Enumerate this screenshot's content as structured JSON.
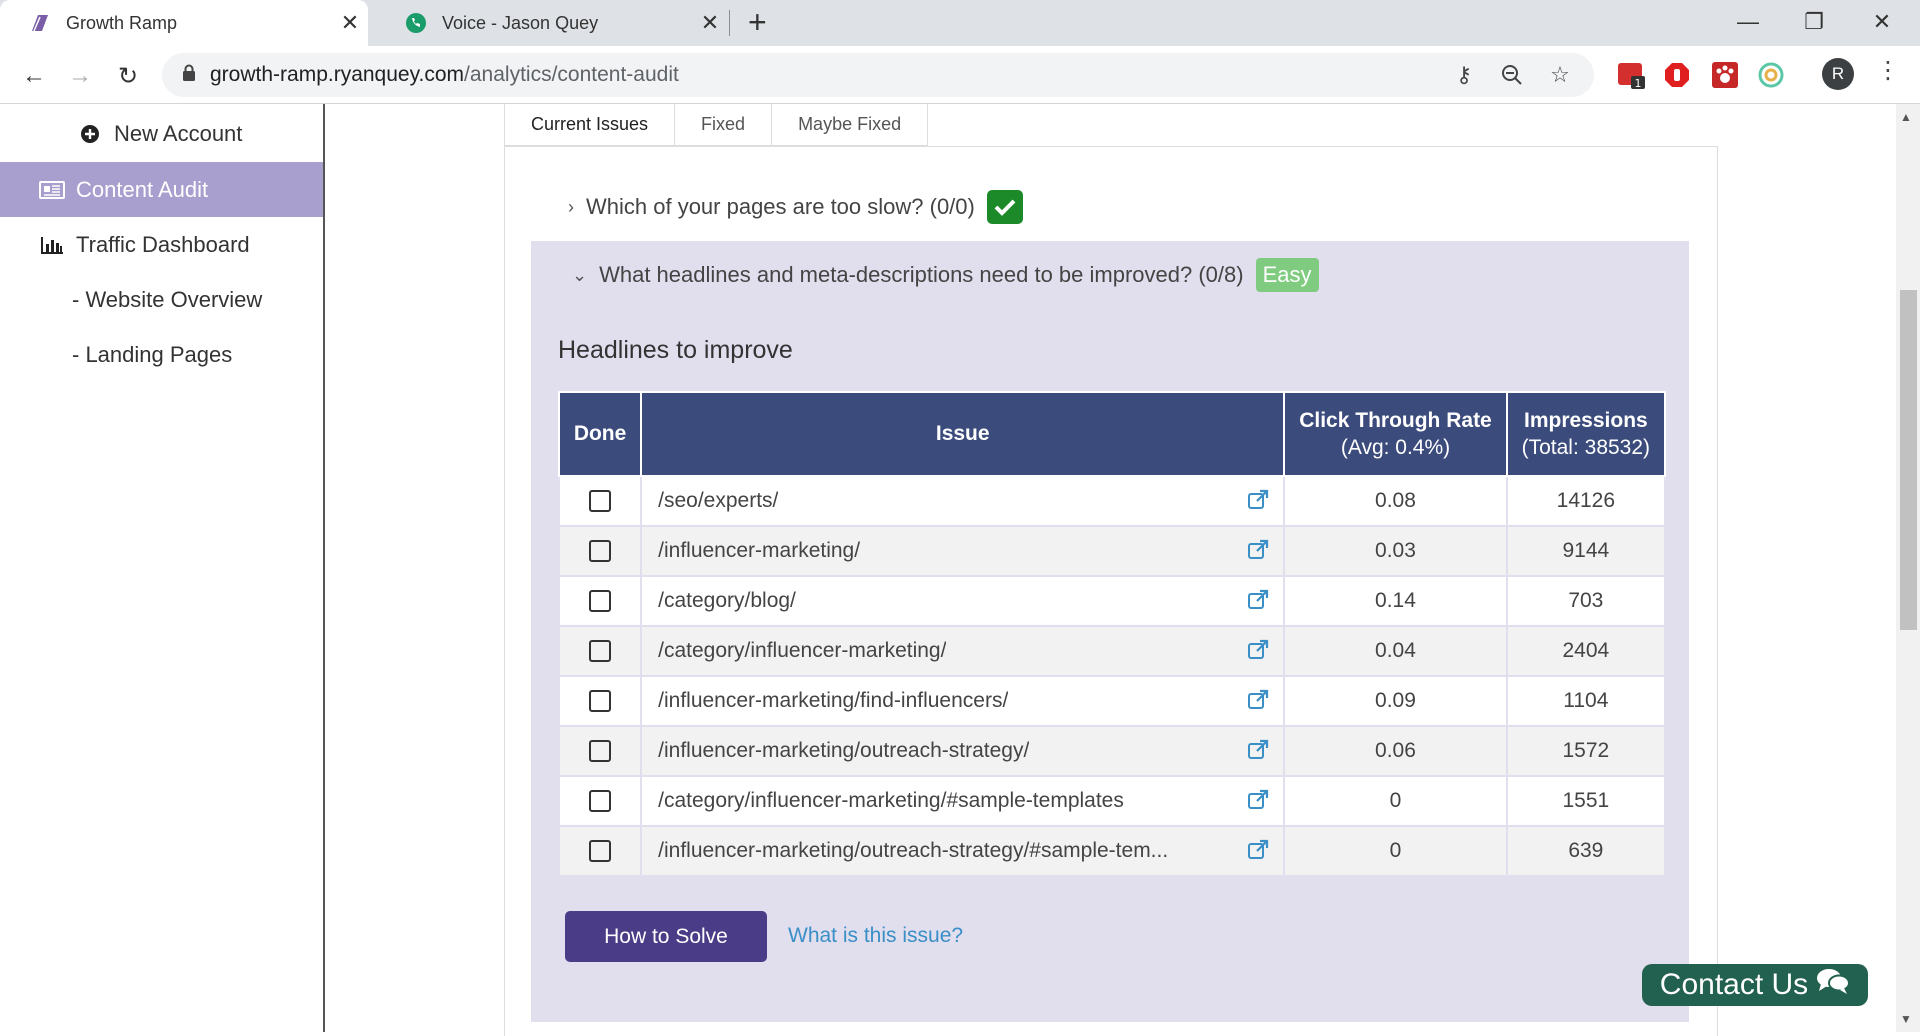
{
  "browser": {
    "tabs": [
      {
        "title": "Growth Ramp",
        "icon": "growth-ramp-favicon",
        "active": true
      },
      {
        "title": "Voice - Jason Quey",
        "icon": "voice-phone-favicon",
        "active": false
      }
    ],
    "url_host": "growth-ramp.ryanquey.com",
    "url_path": "/analytics/content-audit",
    "profile_initial": "R",
    "extension_badge": "1"
  },
  "sidebar": {
    "items": [
      {
        "label": "New Account",
        "icon": "plus-circle-icon"
      },
      {
        "label": "Content Audit",
        "icon": "newspaper-icon",
        "active": true
      },
      {
        "label": "Traffic Dashboard",
        "icon": "bar-chart-icon"
      },
      {
        "label": "- Website Overview"
      },
      {
        "label": "- Landing Pages"
      }
    ]
  },
  "content_tabs": [
    "Current Issues",
    "Fixed",
    "Maybe Fixed"
  ],
  "questions": {
    "slow_pages": "Which of your pages are too slow? (0/0)",
    "headlines": "What headlines and meta-descriptions need to be improved? (0/8)",
    "headlines_badge": "Easy"
  },
  "section_heading": "Headlines to improve",
  "table": {
    "headers": {
      "done": "Done",
      "issue": "Issue",
      "ctr": "Click Through Rate",
      "ctr_sub": "(Avg: 0.4%)",
      "impressions": "Impressions",
      "impressions_sub": "(Total: 38532)"
    },
    "rows": [
      {
        "issue": "/seo/experts/",
        "ctr": "0.08",
        "impressions": "14126"
      },
      {
        "issue": "/influencer-marketing/",
        "ctr": "0.03",
        "impressions": "9144"
      },
      {
        "issue": "/category/blog/",
        "ctr": "0.14",
        "impressions": "703"
      },
      {
        "issue": "/category/influencer-marketing/",
        "ctr": "0.04",
        "impressions": "2404"
      },
      {
        "issue": "/influencer-marketing/find-influencers/",
        "ctr": "0.09",
        "impressions": "1104"
      },
      {
        "issue": "/influencer-marketing/outreach-strategy/",
        "ctr": "0.06",
        "impressions": "1572"
      },
      {
        "issue": "/category/influencer-marketing/#sample-templates",
        "ctr": "0",
        "impressions": "1551"
      },
      {
        "issue": "/influencer-marketing/outreach-strategy/#sample-tem...",
        "ctr": "0",
        "impressions": "639"
      }
    ]
  },
  "actions": {
    "how_to_solve": "How to Solve",
    "what_is_issue": "What is this issue?"
  },
  "contact_us": "Contact Us",
  "colors": {
    "sidebar_active": "#a99fce",
    "table_header": "#3b4b7c",
    "section_bg": "#e1deee",
    "primary_button": "#4a3c87",
    "link": "#3a8fc7",
    "success": "#1d8a2a",
    "easy_badge": "#7fcb7f",
    "contact": "#22604f"
  }
}
